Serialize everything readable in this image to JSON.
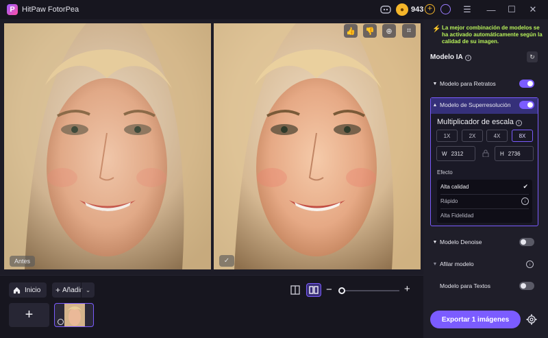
{
  "app": {
    "title": "HitPaw FotorPea",
    "logo_letter": "P",
    "coins": "943"
  },
  "window_controls": {
    "menu": "☰",
    "minimize": "—",
    "maximize": "☐",
    "close": "✕"
  },
  "preview": {
    "before_label": "Antes",
    "after_check": "✓"
  },
  "image_tools": {
    "like": "👍",
    "dislike": "👎",
    "zoom": "⊕",
    "crop": "⌗"
  },
  "bottom": {
    "inicio_label": "Inicio",
    "anadir_label": "Añadir",
    "add_tile": "+",
    "zoom_minus": "−",
    "zoom_plus": "+",
    "zoom_level": 0.0
  },
  "sidebar": {
    "notice": "La mejor combinación de modelos se ha activado automáticamente según la calidad de su imagen.",
    "section_title": "Modelo IA",
    "models": [
      {
        "label": "Modelo para Retratos",
        "on": true
      },
      {
        "label": "Modelo de Superresolución",
        "on": true
      },
      {
        "label": "Modelo Denoise",
        "on": false
      },
      {
        "label": "Afilar modelo"
      },
      {
        "label": "Modelo para Textos",
        "on": false
      }
    ],
    "scale": {
      "title": "Multiplicador de escala",
      "options": [
        "1X",
        "2X",
        "4X",
        "8X"
      ],
      "selected": "8X",
      "width_label": "W",
      "width_value": "2312",
      "height_label": "H",
      "height_value": "2736"
    },
    "effect": {
      "label": "Efecto",
      "options": [
        {
          "label": "Alta calidad",
          "selected": true
        },
        {
          "label": "Rápido"
        },
        {
          "label": "Alta Fidelidad"
        }
      ]
    },
    "export_label": "Exportar 1 imágenes"
  },
  "colors": {
    "accent": "#7b5cff",
    "notice": "#b8f25a",
    "coin": "#f5b62a"
  }
}
